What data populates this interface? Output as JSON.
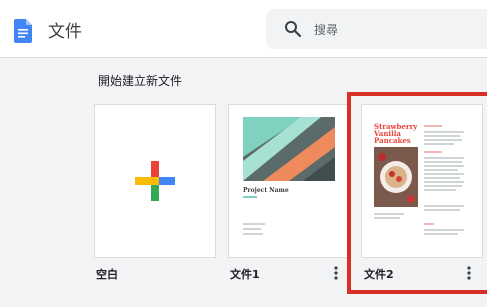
{
  "header": {
    "app_title": "文件",
    "search_placeholder": "搜尋"
  },
  "templates": {
    "section_title": "開始建立新文件",
    "cards": [
      {
        "label": "空白"
      },
      {
        "label": "文件1",
        "preview_title": "Project Name"
      },
      {
        "label": "文件2",
        "preview_title": "Strawberry Vanilla Pancakes"
      }
    ]
  },
  "icons": {
    "docs_logo": "docs-logo-icon",
    "search": "search-icon",
    "plus": "plus-icon",
    "more": "more-vert-icon"
  },
  "colors": {
    "docs_blue": "#4285f4",
    "highlight_red": "#d93025",
    "plus_blue": "#4285f4",
    "plus_red": "#ea4335",
    "plus_yellow": "#fbbc04",
    "plus_green": "#34a853",
    "recipe_red": "#e8453c"
  }
}
